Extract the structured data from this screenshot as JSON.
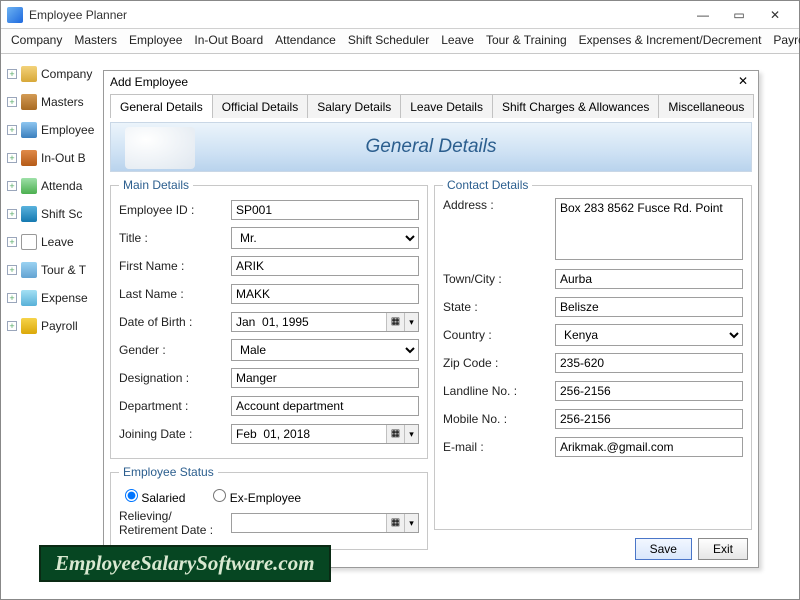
{
  "window": {
    "title": "Employee Planner",
    "min": "—",
    "max": "▭",
    "close": "✕"
  },
  "menubar": [
    "Company",
    "Masters",
    "Employee",
    "In-Out Board",
    "Attendance",
    "Shift Scheduler",
    "Leave",
    "Tour & Training",
    "Expenses & Increment/Decrement",
    "Payroll"
  ],
  "sidebar": {
    "items": [
      {
        "label": "Company"
      },
      {
        "label": "Masters"
      },
      {
        "label": "Employee"
      },
      {
        "label": "In-Out B"
      },
      {
        "label": "Attenda"
      },
      {
        "label": "Shift Sc"
      },
      {
        "label": "Leave"
      },
      {
        "label": "Tour & T"
      },
      {
        "label": "Expense"
      },
      {
        "label": "Payroll"
      }
    ]
  },
  "dialog": {
    "title": "Add Employee",
    "tabs": [
      "General Details",
      "Official Details",
      "Salary Details",
      "Leave Details",
      "Shift Charges & Allowances",
      "Miscellaneous"
    ],
    "banner_title": "General Details",
    "main_details_legend": "Main Details",
    "contact_details_legend": "Contact Details",
    "employee_status_legend": "Employee Status",
    "labels": {
      "employee_id": "Employee ID :",
      "title": "Title :",
      "first_name": "First Name :",
      "last_name": "Last Name :",
      "dob": "Date of Birth :",
      "gender": "Gender :",
      "designation": "Designation :",
      "department": "Department :",
      "joining_date": "Joining Date :",
      "salaried": "Salaried",
      "ex_employee": "Ex-Employee",
      "relieving": "Relieving/\nRetirement Date :",
      "address": "Address :",
      "town": "Town/City :",
      "state": "State :",
      "country": "Country :",
      "zip": "Zip Code :",
      "landline": "Landline No. :",
      "mobile": "Mobile No. :",
      "email": "E-mail :"
    },
    "values": {
      "employee_id": "SP001",
      "title": "Mr.",
      "first_name": "ARIK",
      "last_name": "MAKK",
      "dob": "Jan  01, 1995",
      "gender": "Male",
      "designation": "Manger",
      "department": "Account department",
      "joining_date": "Feb  01, 2018",
      "address": "Box 283 8562 Fusce Rd. Point",
      "town": "Aurba",
      "state": "Belisze",
      "country": "Kenya",
      "zip": "235-620",
      "landline": "256-2156",
      "mobile": "256-2156",
      "email": "Arikmak.@gmail.com"
    },
    "buttons": {
      "save": "Save",
      "exit": "Exit"
    }
  },
  "watermark": "EmployeeSalarySoftware.com"
}
